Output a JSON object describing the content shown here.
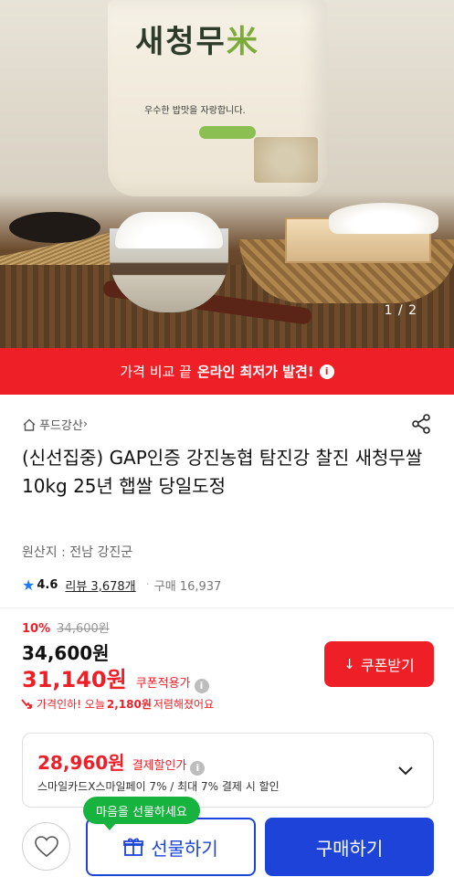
{
  "hero": {
    "bag_brand": "새청무",
    "bag_tagline": "우수한 밥맛을 자랑합니다.",
    "counter": "1 / 2"
  },
  "banner": {
    "prefix": "가격 비교 끝",
    "strong": "온라인 최저가 발견!",
    "info_icon": "i"
  },
  "store": {
    "name": "푸드강산",
    "chevron": "›"
  },
  "product": {
    "title": "(신선집중) GAP인증 강진농협 탐진강 찰진 새청무쌀 10kg 25년 햅쌀 당일도정",
    "origin": "원산지 : 전남 강진군"
  },
  "rating": {
    "star": "★",
    "score": "4.6",
    "review_label": "리뷰 3,678개",
    "separator": "·",
    "purchase": "구매 16,937"
  },
  "price": {
    "discount_pct": "10%",
    "original": "34,600원",
    "main": "34,600원",
    "coupon_price": "31,140원",
    "coupon_label": "쿠폰적용가",
    "info_icon": "i",
    "price_drop_prefix": "가격인하! 오늘",
    "price_drop_amount": "2,180원",
    "price_drop_suffix": "저렴해졌어요"
  },
  "coupon_button": {
    "label": "쿠폰받기",
    "icon": "↓"
  },
  "payment_card": {
    "price": "28,960원",
    "label": "결제할인가",
    "info_icon": "i",
    "description": "스마일카드X스마일페이 7% / 최대 7% 결제 시 할인"
  },
  "bottom_bar": {
    "tooltip": "마음을 선물하세요",
    "gift_label": "선물하기",
    "buy_label": "구매하기"
  },
  "colors": {
    "accent_red": "#ef1f28",
    "accent_blue": "#1d43d9",
    "tooltip_green": "#16b33f",
    "star_blue": "#1e7cf0"
  }
}
